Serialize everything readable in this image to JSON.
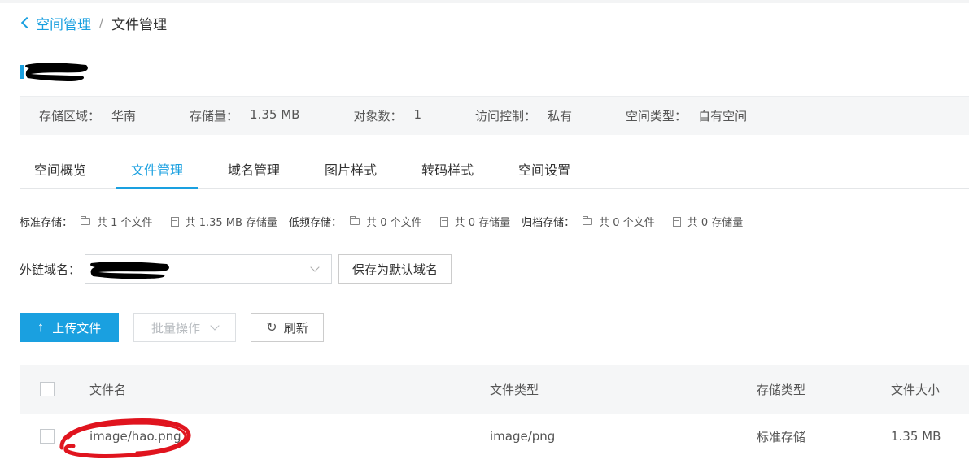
{
  "breadcrumb": {
    "parent": "空间管理",
    "separator": "/",
    "current": "文件管理"
  },
  "info_bar": [
    {
      "key": "存储区域：",
      "value": "华南"
    },
    {
      "key": "存储量：",
      "value": "1.35 MB"
    },
    {
      "key": "对象数：",
      "value": "1"
    },
    {
      "key": "访问控制：",
      "value": "私有"
    },
    {
      "key": "空间类型：",
      "value": "自有空间"
    }
  ],
  "tabs": [
    "空间概览",
    "文件管理",
    "域名管理",
    "图片样式",
    "转码样式",
    "空间设置"
  ],
  "active_tab": "文件管理",
  "stats": {
    "standard": {
      "label": "标准存储：",
      "files": "共 1 个文件",
      "size": "共 1.35 MB 存储量"
    },
    "infrequent": {
      "label": "低频存储：",
      "files": "共 0 个文件",
      "size": "共 0 存储量"
    },
    "archive": {
      "label": "归档存储：",
      "files": "共 0 个文件",
      "size": "共 0 存储量"
    }
  },
  "domain": {
    "label": "外链域名：",
    "save_default": "保存为默认域名"
  },
  "toolbar": {
    "upload": "上传文件",
    "batch": "批量操作",
    "refresh": "刷新"
  },
  "table": {
    "headers": {
      "name": "文件名",
      "type": "文件类型",
      "storage": "存储类型",
      "size": "文件大小"
    },
    "rows": [
      {
        "name": "image/hao.png",
        "type": "image/png",
        "storage": "标准存储",
        "size": "1.35 MB"
      }
    ]
  },
  "colors": {
    "accent": "#1aa0e0",
    "annotation": "#e0141e",
    "redaction": "#000000"
  }
}
